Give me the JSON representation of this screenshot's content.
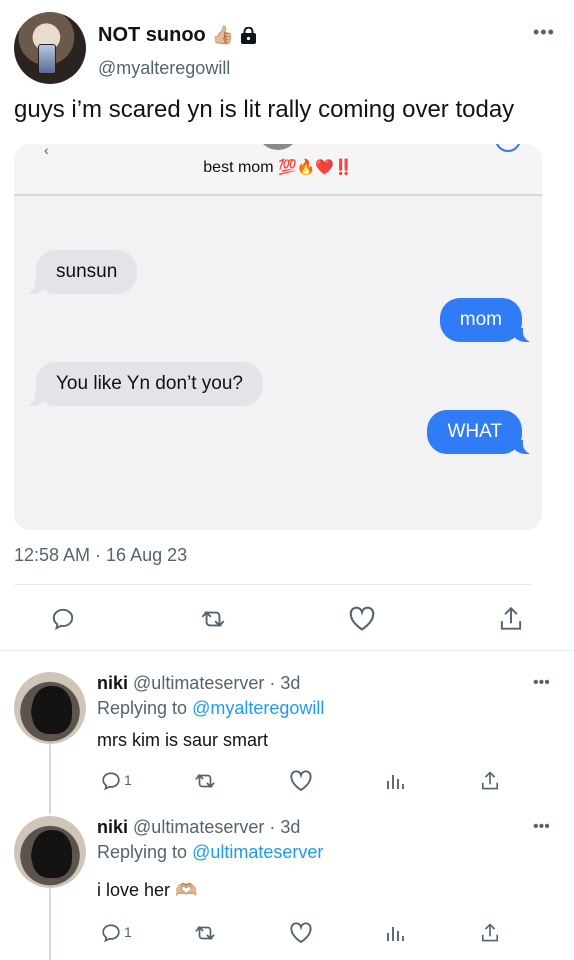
{
  "tweet": {
    "display_name": "NOT sunoo",
    "name_emoji": "👍🏼",
    "handle": "@myalteregowill",
    "text": "guys i’m scared yn is lit rally coming over today",
    "more": "•••",
    "timestamp": "12:58 AM · 16 Aug 23"
  },
  "chat": {
    "contact_name": "best mom",
    "contact_emoji": "💯🔥❤️‼️",
    "messages": [
      {
        "side": "received",
        "text": "sunsun"
      },
      {
        "side": "sent",
        "text": "mom"
      },
      {
        "side": "received",
        "text": "You like Yn don’t you?"
      },
      {
        "side": "sent",
        "text": "WHAT"
      }
    ]
  },
  "actions": {
    "reply_icon": "reply-icon",
    "retweet_icon": "retweet-icon",
    "like_icon": "heart-icon",
    "share_icon": "share-icon"
  },
  "replies": [
    {
      "name": "niki",
      "handle": "@ultimateserver",
      "age": "· 3d",
      "replying_prefix": "Replying to",
      "replying_to": "@myalteregowill",
      "text": "mrs kim is saur smart",
      "reply_count": "1",
      "more": "•••"
    },
    {
      "name": "niki",
      "handle": "@ultimateserver",
      "age": "· 3d",
      "replying_prefix": "Replying to",
      "replying_to": "@ultimateserver",
      "text": "i love her 🫶🏼",
      "reply_count": "1",
      "more": "•••"
    }
  ],
  "colors": {
    "link": "#1d9bf0",
    "sent_bubble": "#2f7cf6",
    "received_bubble": "#e4e4e8",
    "muted_text": "#536471"
  }
}
